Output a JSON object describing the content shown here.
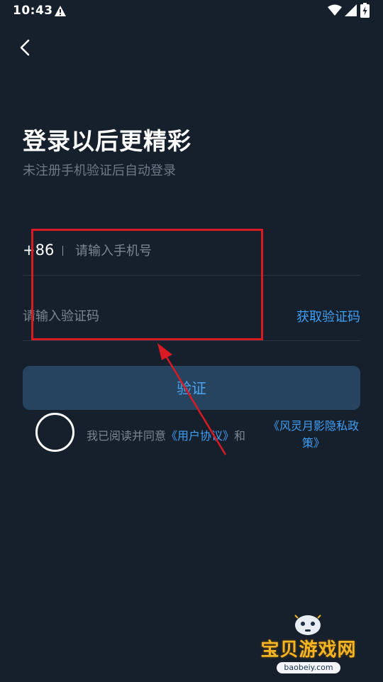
{
  "status_bar": {
    "time": "10:43"
  },
  "header": {
    "title": "登录以后更精彩",
    "subtitle": "未注册手机验证后自动登录"
  },
  "form": {
    "country_code": "+86",
    "phone_placeholder": "请输入手机号",
    "phone_value": "",
    "code_placeholder": "请输入验证码",
    "code_value": "",
    "get_code_label": "获取验证码",
    "verify_label": "验证"
  },
  "agreement": {
    "checked": false,
    "prefix": "我已阅读并同意",
    "user_agreement": "《用户协议》",
    "conjunction": "和",
    "privacy_policy": "《风灵月影隐私政策》"
  },
  "watermark": {
    "title": "宝贝游戏网",
    "url": "baobeiy.com"
  },
  "colors": {
    "background": "#16202d",
    "accent": "#3f9ff5",
    "button_bg": "#26445f",
    "annotation": "#d81a22"
  },
  "icons": [
    "back-arrow-icon",
    "warning-icon",
    "wifi-icon",
    "signal-icon",
    "battery-icon"
  ]
}
